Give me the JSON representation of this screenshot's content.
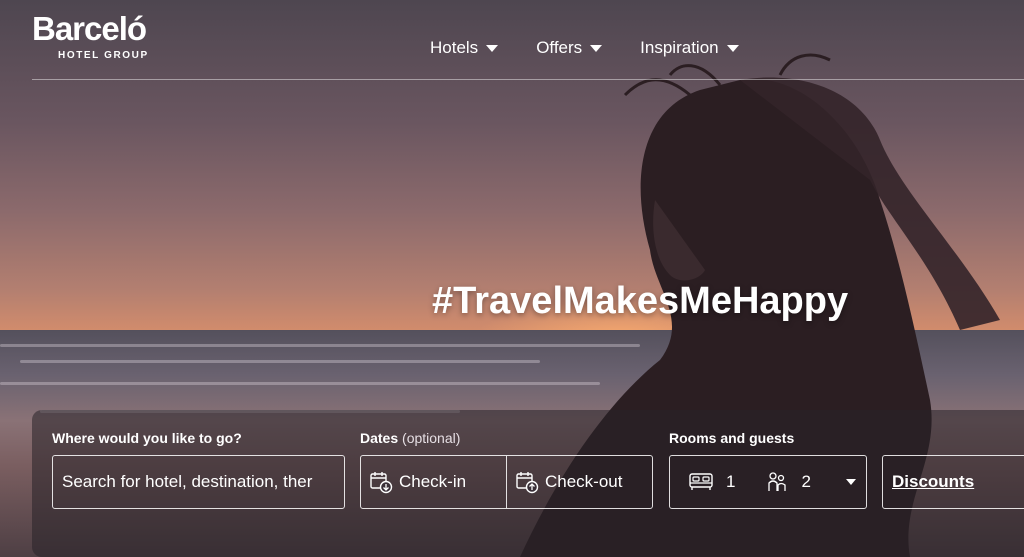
{
  "brand": {
    "name": "Barceló",
    "subtitle": "HOTEL GROUP"
  },
  "nav": {
    "items": [
      {
        "label": "Hotels"
      },
      {
        "label": "Offers"
      },
      {
        "label": "Inspiration"
      }
    ]
  },
  "hero": {
    "hashtag": "#TravelMakesMeHappy"
  },
  "search": {
    "destination_label": "Where would you like to go?",
    "destination_placeholder": "Search for hotel, destination, ther",
    "dates_label": "Dates",
    "dates_optional": "(optional)",
    "checkin_label": "Check-in",
    "checkout_label": "Check-out",
    "rooms_label": "Rooms and guests",
    "rooms_count": "1",
    "guests_count": "2",
    "discounts_label": "Discounts"
  },
  "icons": {
    "nav_caret": "caret-down-icon",
    "checkin": "calendar-down-icon",
    "checkout": "calendar-up-icon",
    "rooms": "bed-icon",
    "guests": "people-icon",
    "rooms_dropdown": "caret-down-icon"
  }
}
